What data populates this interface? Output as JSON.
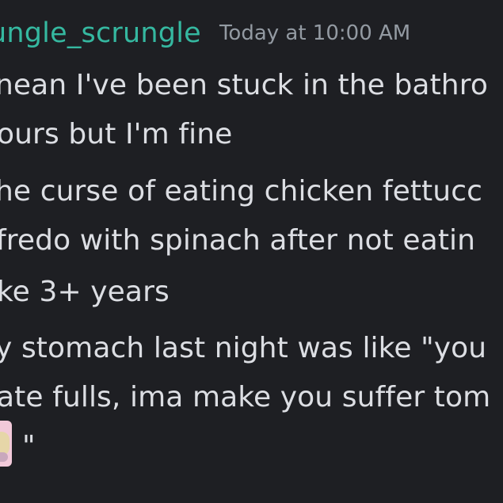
{
  "message": {
    "username": "ungle_scrungle",
    "timestamp": "Today at 10:00 AM",
    "lines": [
      "nean I've been stuck in the bathro",
      "ours but I'm fine",
      "he curse of eating chicken fettucc",
      "fredo with spinach after not eatin",
      "ke 3+ years",
      "y stomach last night was like \"you",
      "ate fulls, ima make you suffer tom",
      "\""
    ],
    "emoji": "custom-emoji"
  },
  "colors": {
    "background": "#1e1f23",
    "username": "#35b8a0",
    "timestamp": "#939aa2",
    "text": "#dcdee3"
  }
}
